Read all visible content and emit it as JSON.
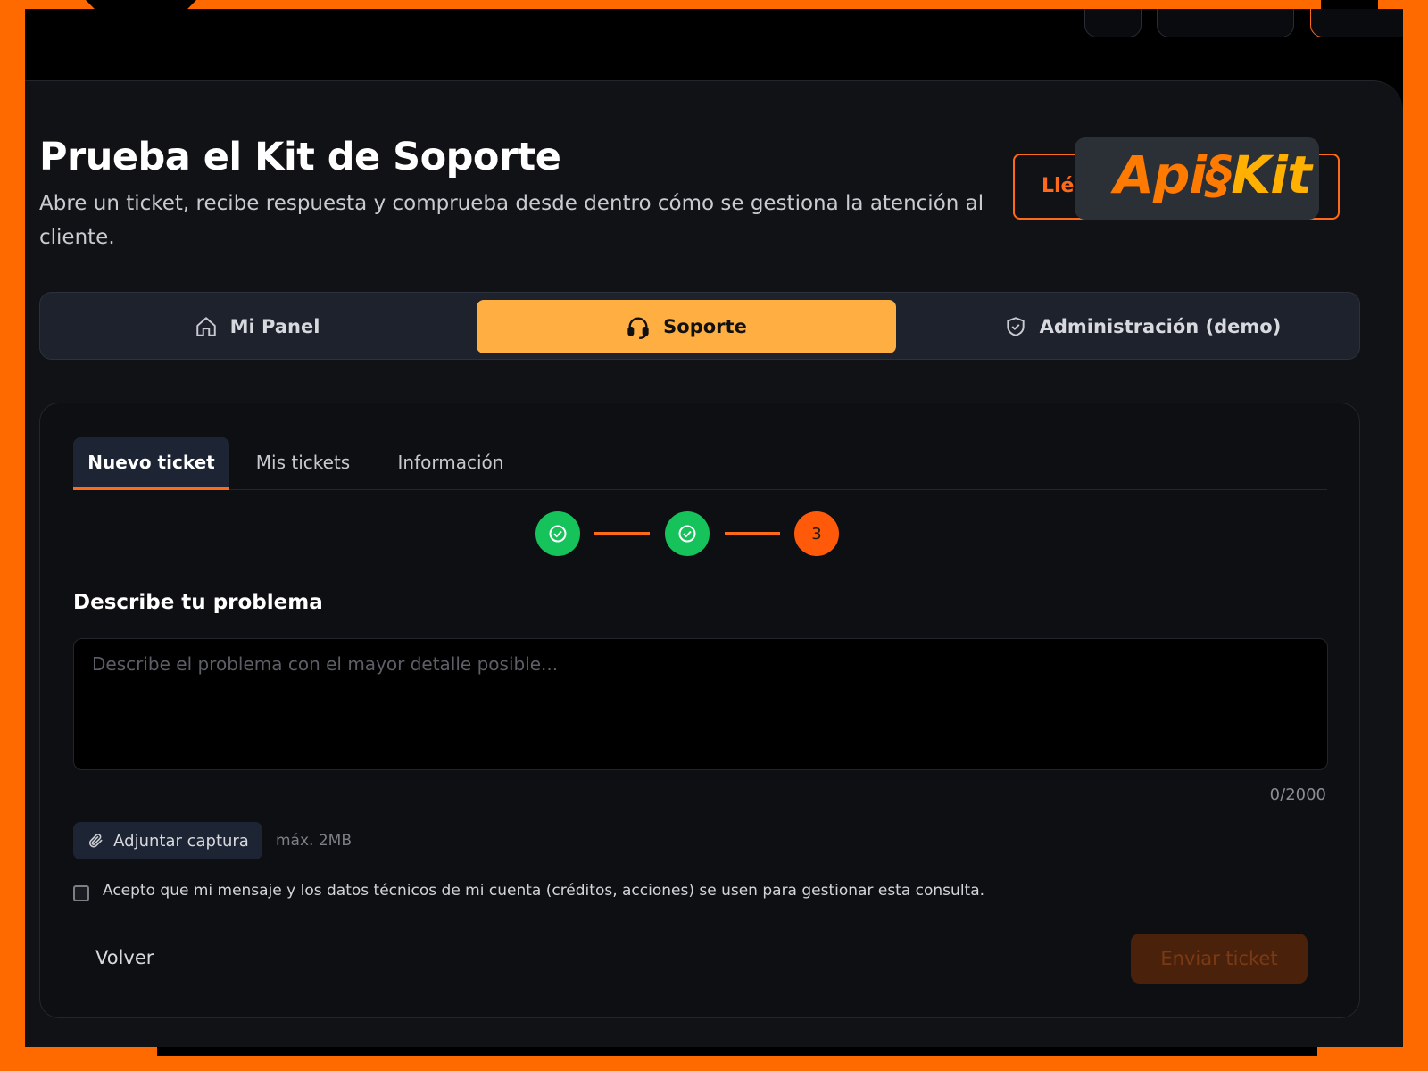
{
  "header": {
    "title": "Prueba el Kit de Soporte",
    "subtitle": "Abre un ticket, recibe respuesta y comprueba desde dentro cómo se gestiona la atención al cliente.",
    "cta_label": "Llév",
    "logo_text_a": "Api",
    "logo_text_b": "Kit"
  },
  "nav": {
    "items": [
      {
        "label": "Mi Panel",
        "icon": "home-icon"
      },
      {
        "label": "Soporte",
        "icon": "headset-icon",
        "active": true
      },
      {
        "label": "Administración (demo)",
        "icon": "shield-icon"
      }
    ]
  },
  "tabs": [
    {
      "label": "Nuevo ticket",
      "active": true
    },
    {
      "label": "Mis tickets"
    },
    {
      "label": "Información"
    }
  ],
  "stepper": {
    "steps": [
      {
        "state": "done",
        "icon": "check-icon"
      },
      {
        "state": "done",
        "icon": "check-icon"
      },
      {
        "state": "current",
        "label": "3"
      }
    ]
  },
  "form": {
    "section_label": "Describe tu problema",
    "description_placeholder": "Describe el problema con el mayor detalle posible...",
    "description_value": "",
    "counter": "0/2000",
    "attach_label": "Adjuntar captura",
    "max_size": "máx. 2MB",
    "consent_text": "Acepto que mi mensaje y los datos técnicos de mi cuenta (créditos, acciones) se usen para gestionar esta consulta.",
    "consent_checked": false,
    "back_label": "Volver",
    "submit_label": "Enviar ticket"
  },
  "colors": {
    "frame": "#ff6a00",
    "accent": "#ffae42",
    "success": "#16c25a",
    "step_current": "#ff5a0a"
  }
}
